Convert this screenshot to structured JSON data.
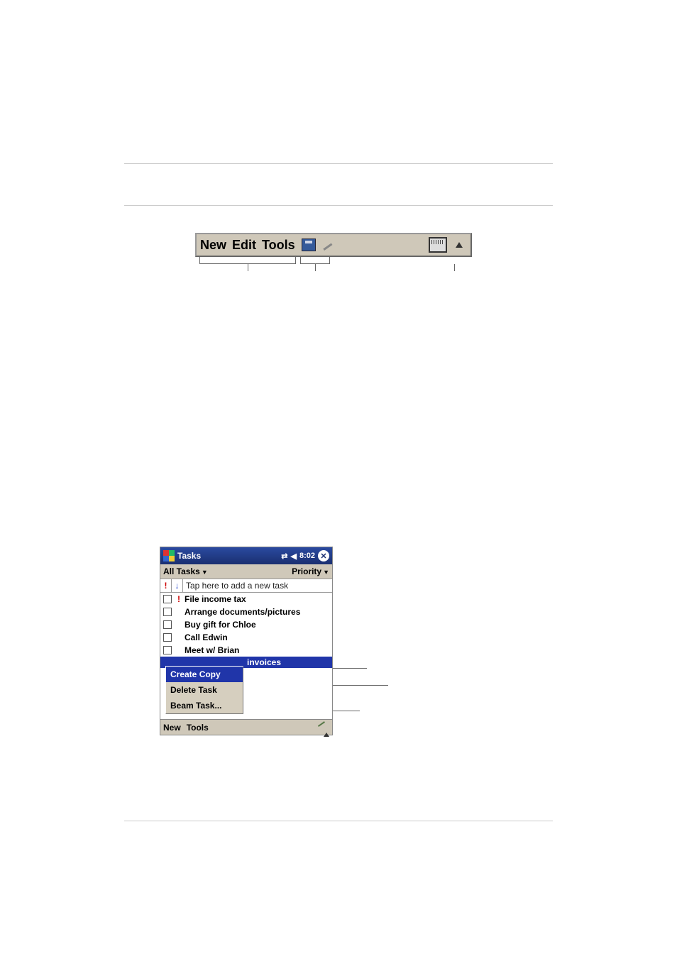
{
  "cmdbar": {
    "new": "New",
    "edit": "Edit",
    "tools": "Tools"
  },
  "pda": {
    "title": "Tasks",
    "time": "8:02",
    "filter_left": "All Tasks",
    "filter_right": "Priority",
    "entry_hint": "Tap here to add a new task",
    "tasks": [
      {
        "priority_high": true,
        "label": "File income tax"
      },
      {
        "priority_high": false,
        "label": "Arrange documents/pictures"
      },
      {
        "priority_high": false,
        "label": "Buy gift for Chloe"
      },
      {
        "priority_high": false,
        "label": "Call Edwin"
      },
      {
        "priority_high": false,
        "label": "Meet w/ Brian"
      }
    ],
    "highlight_tail": "invoices",
    "context_menu": {
      "create_copy": "Create Copy",
      "delete_task": "Delete Task",
      "beam_task": "Beam Task..."
    },
    "bottom_new": "New",
    "bottom_tools": "Tools"
  }
}
